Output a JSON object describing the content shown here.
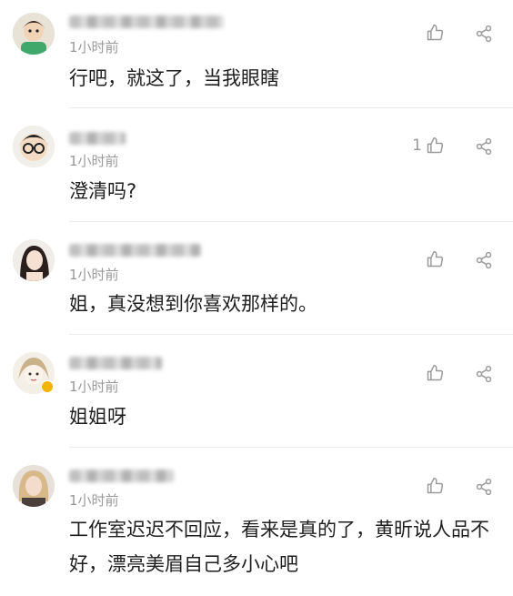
{
  "comments": [
    {
      "time": "1小时前",
      "content": "行吧，就这了，当我眼瞎",
      "likes": ""
    },
    {
      "time": "1小时前",
      "content": "澄清吗?",
      "likes": "1"
    },
    {
      "time": "1小时前",
      "content": "姐，真没想到你喜欢那样的。",
      "likes": ""
    },
    {
      "time": "1小时前",
      "content": "姐姐呀",
      "likes": ""
    },
    {
      "time": "1小时前",
      "content": "工作室迟迟不回应，看来是真的了，黄昕说人品不好，漂亮美眉自己多小心吧",
      "likes": ""
    }
  ],
  "icons": {
    "like": "thumbs-up-icon",
    "share": "share-icon"
  },
  "colors": {
    "icon_gray": "#9a9a9a",
    "time_gray": "#9a9a9a",
    "text": "#1e1e1e"
  }
}
